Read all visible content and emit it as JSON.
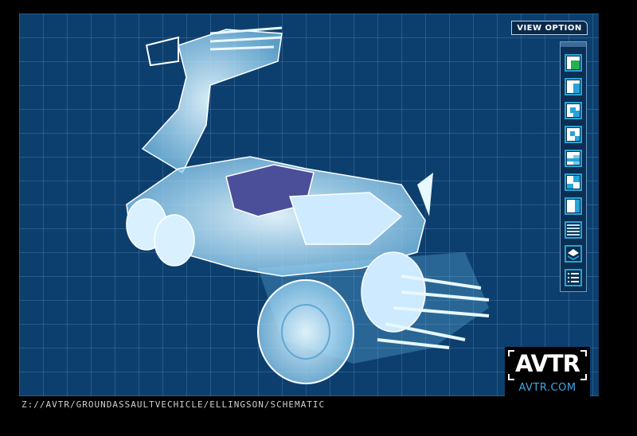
{
  "view_option": {
    "label": "VIEW OPTION"
  },
  "view_buttons": [
    {
      "icon": "solid-view-icon"
    },
    {
      "icon": "view-mode-2-icon"
    },
    {
      "icon": "view-mode-3-icon"
    },
    {
      "icon": "view-mode-4-icon"
    },
    {
      "icon": "view-mode-5-icon"
    },
    {
      "icon": "view-mode-6-icon"
    },
    {
      "icon": "view-mode-7-icon"
    },
    {
      "icon": "lines-icon"
    },
    {
      "icon": "layers-icon"
    },
    {
      "icon": "list-icon"
    }
  ],
  "file_path": "Z://AVTR/GROUNDASSAULTVECHICLE/ELLINGSON/SCHEMATIC",
  "logo": {
    "word": "AVTR",
    "url": "AVTR.COM"
  },
  "colors": {
    "grid_bg": "#0d3f6e",
    "accent": "#27a3d8",
    "active": "#22b14c"
  }
}
